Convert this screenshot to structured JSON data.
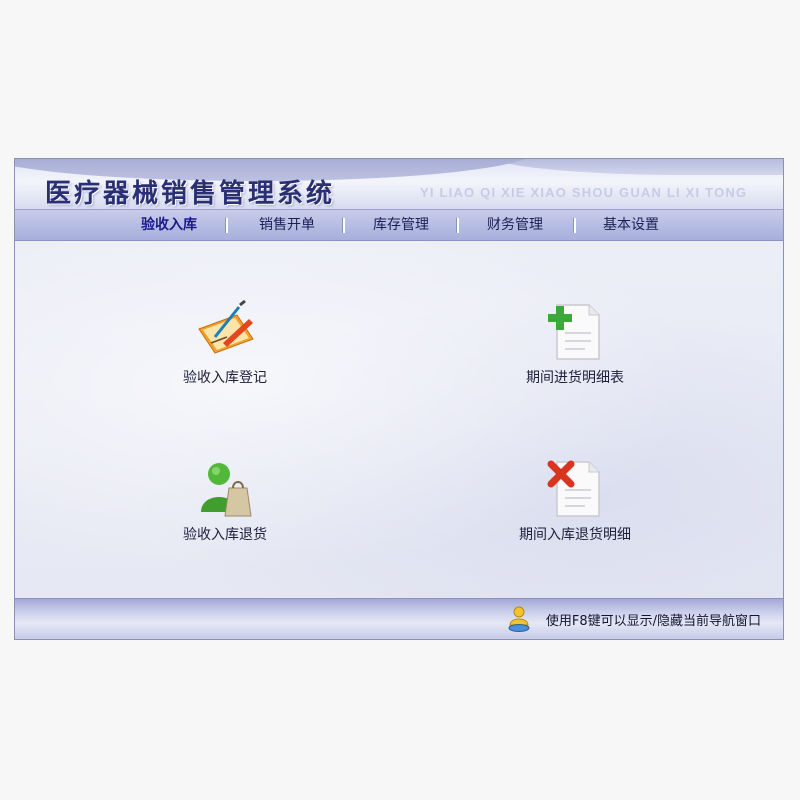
{
  "app": {
    "title": "医疗器械销售管理系统",
    "subtitle": "YI LIAO QI XIE XIAO SHOU GUAN LI XI TONG"
  },
  "nav": {
    "items": [
      {
        "label": "验收入库",
        "active": true
      },
      {
        "label": "销售开单",
        "active": false
      },
      {
        "label": "库存管理",
        "active": false
      },
      {
        "label": "财务管理",
        "active": false
      },
      {
        "label": "基本设置",
        "active": false
      }
    ]
  },
  "tiles": [
    {
      "label": "验收入库登记",
      "icon": "edit-document-icon"
    },
    {
      "label": "期间进货明细表",
      "icon": "add-document-icon"
    },
    {
      "label": "验收入库退货",
      "icon": "user-return-bag-icon"
    },
    {
      "label": "期间入库退货明细",
      "icon": "delete-document-icon"
    }
  ],
  "footer": {
    "hint": "使用F8键可以显示/隐藏当前导航窗口",
    "icon": "user-info-icon"
  },
  "colors": {
    "title": "#2a2f74",
    "nav_bar": "#b7bde3",
    "accent_green": "#3aa83a",
    "accent_red": "#d9341f",
    "accent_orange": "#f08a1c"
  }
}
